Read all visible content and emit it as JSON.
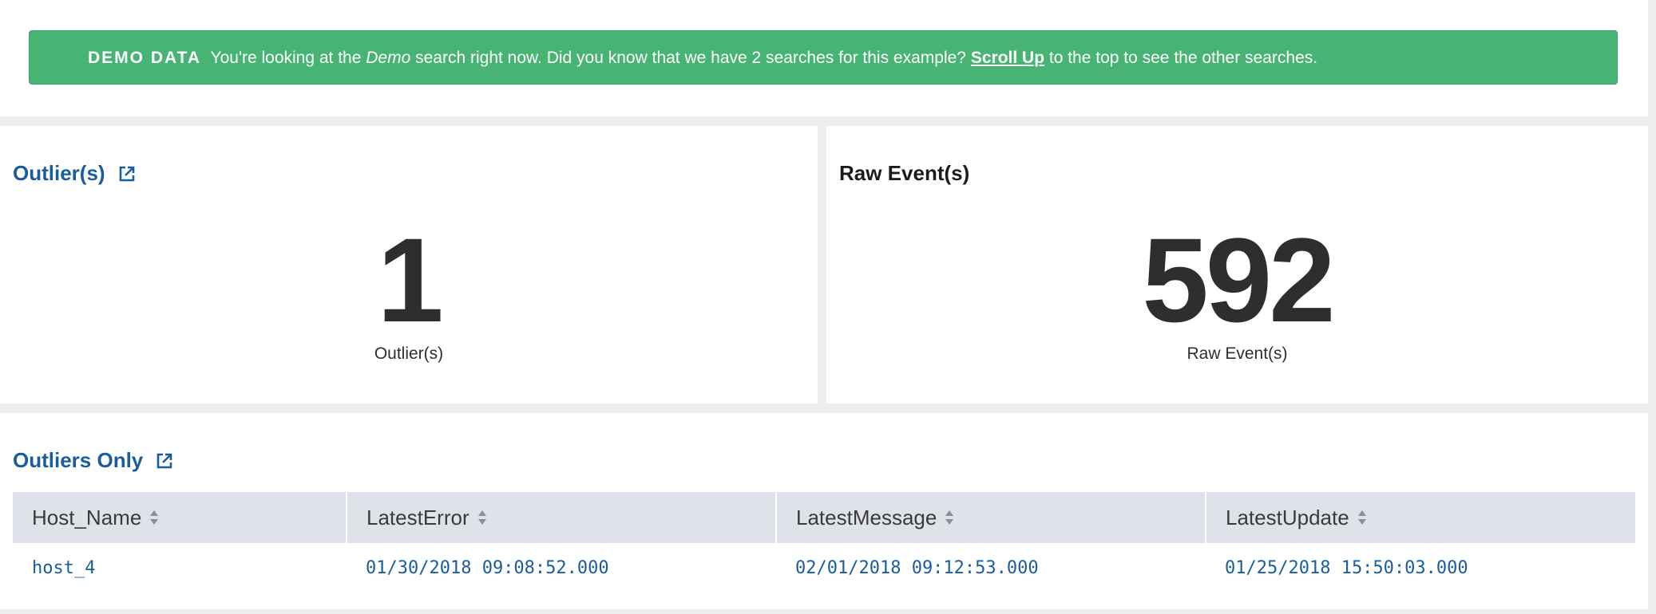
{
  "banner": {
    "tag": "DEMO DATA",
    "text_before": "You're looking at the",
    "emphasis": "Demo",
    "text_middle": "search right now. Did you know that we have 2 searches for this example?",
    "link": "Scroll Up",
    "text_after": "to the top to see the other searches.",
    "color": "#47b474"
  },
  "outliers_panel": {
    "title": "Outlier(s)",
    "title_icon": "external-link-icon",
    "value": "1",
    "label": "Outlier(s)"
  },
  "raw_events_panel": {
    "title": "Raw Event(s)",
    "value": "592",
    "label": "Raw Event(s)"
  },
  "outliers_table": {
    "title": "Outliers Only",
    "title_icon": "external-link-icon",
    "sort_icon": "sort-icon",
    "columns": [
      "Host_Name",
      "LatestError",
      "LatestMessage",
      "LatestUpdate"
    ],
    "rows": [
      [
        "host_4",
        "01/30/2018 09:08:52.000",
        "02/01/2018 09:12:53.000",
        "01/25/2018 15:50:03.000"
      ]
    ]
  },
  "colors": {
    "link": "#1a5d9c",
    "header_bg": "#dfe3e9",
    "value_text": "#2e2e2e"
  }
}
